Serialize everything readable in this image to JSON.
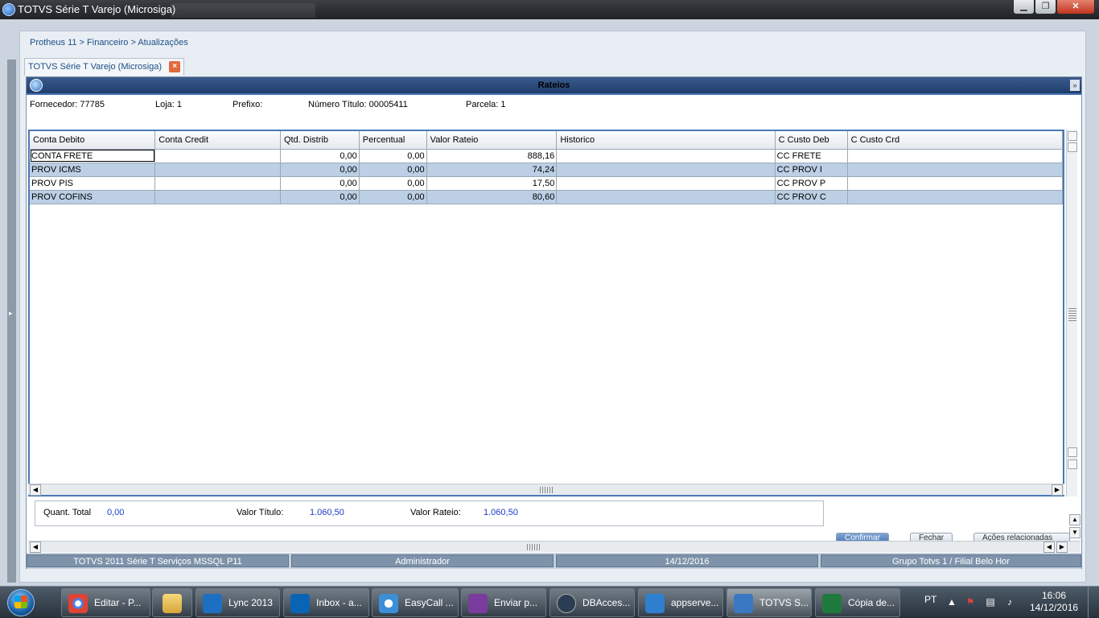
{
  "window": {
    "title": "TOTVS Série T Varejo (Microsiga)",
    "minimize": "▁",
    "maximize": "❐",
    "close": "✕"
  },
  "breadcrumb": "Protheus 11 > Financeiro > Atualizações",
  "app_tab": {
    "label": "TOTVS Série T Varejo (Microsiga)",
    "close": "×"
  },
  "dialog": {
    "title": "Rateios",
    "info": {
      "fornecedor": "Fornecedor: 77785",
      "loja": "Loja: 1",
      "prefixo": "Prefixo:",
      "numero_titulo": "Número Título: 00005411",
      "parcela": "Parcela: 1"
    },
    "grid": {
      "columns": [
        "Conta Debito",
        "Conta Credit",
        "Qtd. Distrib",
        "Percentual",
        "Valor Rateio",
        "Historico",
        "C Custo Deb",
        "C Custo Crd"
      ],
      "rows": [
        [
          "CONTA FRETE",
          "",
          "0,00",
          "0,00",
          "888,16",
          "",
          "CC FRETE",
          ""
        ],
        [
          "PROV ICMS",
          "",
          "0,00",
          "0,00",
          "74,24",
          "",
          "CC PROV I",
          ""
        ],
        [
          "PROV PIS",
          "",
          "0,00",
          "0,00",
          "17,50",
          "",
          "CC PROV P",
          ""
        ],
        [
          "PROV COFINS",
          "",
          "0,00",
          "0,00",
          "80,60",
          "",
          "CC PROV C",
          ""
        ]
      ]
    },
    "totals": {
      "quant_total_label": "Quant. Total",
      "quant_total_value": "0,00",
      "valor_titulo_label": "Valor Título:",
      "valor_titulo_value": "1.060,50",
      "valor_rateio_label": "Valor Rateio:",
      "valor_rateio_value": "1.060,50"
    },
    "buttons": {
      "confirmar": "Confirmar",
      "fechar": "Fechar",
      "acoes": "Ações relacionadas"
    },
    "scroll": {
      "left": "◀",
      "right": "▶",
      "up": "▲",
      "down": "▼"
    }
  },
  "statusbar": {
    "system": "TOTVS 2011 Série T Serviços MSSQL P11",
    "user": "Administrador",
    "date": "14/12/2016",
    "branch": "Grupo Totvs 1 / Filial Belo Hor"
  },
  "taskbar": {
    "items": [
      {
        "label": "Editar - P...",
        "icon": "chrome-icon",
        "color": "#dd4b39"
      },
      {
        "label": "",
        "icon": "folder-icon",
        "color": "#e8c15a"
      },
      {
        "label": "Lync 2013",
        "icon": "lync-icon",
        "color": "#1d6fc2"
      },
      {
        "label": "Inbox - a...",
        "icon": "outlook-icon",
        "color": "#0a64b5"
      },
      {
        "label": "EasyCall ...",
        "icon": "easycall-icon",
        "color": "#3a8fd6"
      },
      {
        "label": "Enviar p...",
        "icon": "onenote-icon",
        "color": "#7a3c9e"
      },
      {
        "label": "DBAcces...",
        "icon": "dbaccess-icon",
        "color": "#2b3d52"
      },
      {
        "label": "appserve...",
        "icon": "appserver-icon",
        "color": "#2f7fcf"
      },
      {
        "label": "TOTVS S...",
        "icon": "totvs-icon",
        "color": "#3a78c4"
      },
      {
        "label": "Cópia de...",
        "icon": "excel-icon",
        "color": "#1e7a3c"
      }
    ],
    "language": "PT",
    "clock_time": "16:06",
    "clock_date": "14/12/2016"
  }
}
